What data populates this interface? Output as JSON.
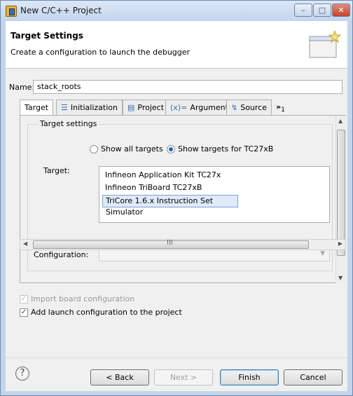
{
  "window": {
    "title": "New C/C++ Project",
    "controls": {
      "minimize": "–",
      "maximize": "□",
      "close": "✕"
    }
  },
  "header": {
    "title": "Target Settings",
    "description": "Create a configuration to launch the debugger"
  },
  "name_field": {
    "label": "Name:",
    "value": "stack_roots"
  },
  "tabs": [
    {
      "label": "Target",
      "icon": "target-tab-icon",
      "active": true
    },
    {
      "label": "Initialization",
      "icon": "list-icon",
      "active": false
    },
    {
      "label": "Project",
      "icon": "document-icon",
      "active": false
    },
    {
      "label": "Arguments",
      "icon": "arguments-icon",
      "active": false
    },
    {
      "label": "Source",
      "icon": "source-icon",
      "active": false
    },
    {
      "label": "1",
      "icon": "overflow-chevron-icon",
      "active": false
    }
  ],
  "tab_glyphs": {
    "initialization": "☰",
    "project": "▤",
    "arguments": "(x)=",
    "source": "↯",
    "overflow": "»"
  },
  "target_settings": {
    "group_title": "Target settings",
    "radio_show_all": "Show all targets",
    "radio_show_for": "Show targets for TC27xB",
    "selected_radio": "Show targets for TC27xB",
    "target_label": "Target:",
    "targets": [
      "Infineon Application Kit TC27x",
      "Infineon TriBoard TC27xB",
      "TriCore 1.6.x Instruction Set Simulator"
    ],
    "selected_target": "TriCore 1.6.x Instruction Set Simulator",
    "configuration_label": "Configuration:",
    "configuration_value": ""
  },
  "options": {
    "import_board_config": {
      "label": "Import board configuration",
      "checked": true,
      "enabled": false
    },
    "add_launch_config": {
      "label": "Add launch configuration to the project",
      "checked": true,
      "enabled": true
    }
  },
  "footer": {
    "help": "?",
    "back": "< Back",
    "next": "Next >",
    "finish": "Finish",
    "cancel": "Cancel"
  },
  "scrollbar_glyphs": {
    "up": "▲",
    "down": "▼",
    "left": "◀",
    "right": "▶",
    "grip": "III"
  }
}
